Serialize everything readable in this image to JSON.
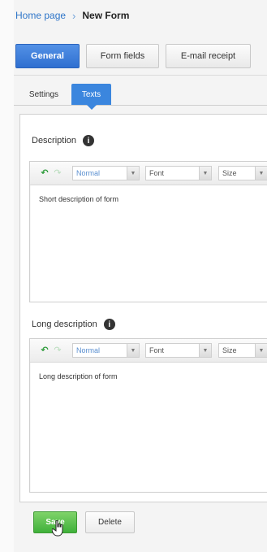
{
  "breadcrumb": {
    "home": "Home page",
    "separator": "›",
    "current": "New Form"
  },
  "main_tabs": [
    {
      "label": "General",
      "active": true
    },
    {
      "label": "Form fields",
      "active": false
    },
    {
      "label": "E-mail receipt",
      "active": false
    }
  ],
  "sub_tabs": [
    {
      "label": "Settings",
      "active": false
    },
    {
      "label": "Texts",
      "active": true
    }
  ],
  "description": {
    "label": "Description",
    "info_icon": "i",
    "toolbar": {
      "format": "Normal",
      "font": "Font",
      "size": "Size",
      "arrow": "▼"
    },
    "text": "Short description of form"
  },
  "long_description": {
    "label": "Long description",
    "info_icon": "i",
    "toolbar": {
      "format": "Normal",
      "font": "Font",
      "size": "Size",
      "arrow": "▼"
    },
    "text": "Long description of form"
  },
  "actions": {
    "save_label": "Save",
    "delete_label": "Delete"
  },
  "colors": {
    "accent": "#3b86de",
    "save": "#4fbe43"
  }
}
